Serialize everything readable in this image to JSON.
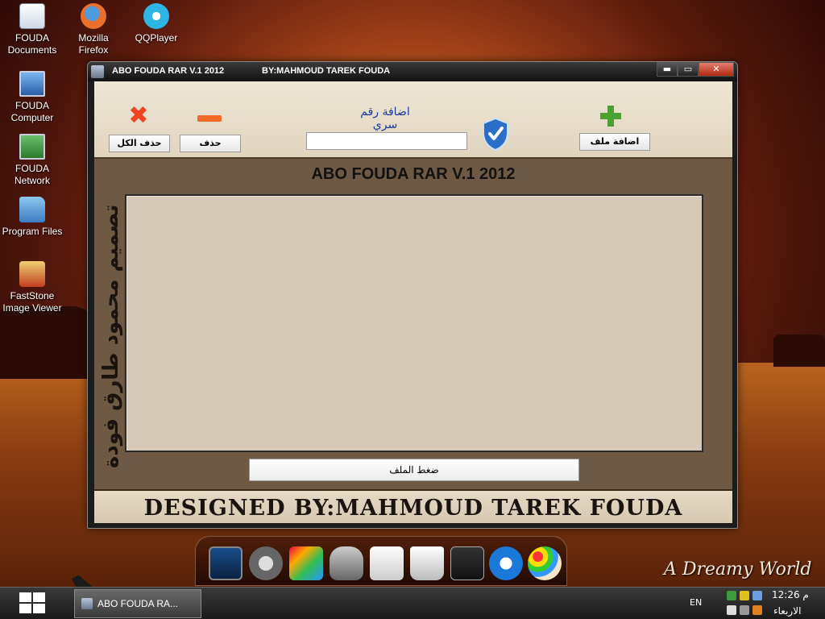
{
  "desktop": {
    "icons": [
      {
        "label_line1": "FOUDA",
        "label_line2": "Documents"
      },
      {
        "label_line1": "Mozilla",
        "label_line2": "Firefox"
      },
      {
        "label_line1": "QQPlayer",
        "label_line2": ""
      },
      {
        "label_line1": "FOUDA",
        "label_line2": "Computer"
      },
      {
        "label_line1": "FOUDA",
        "label_line2": "Network"
      },
      {
        "label_line1": "Program Files",
        "label_line2": ""
      },
      {
        "label_line1": "FastStone",
        "label_line2": "Image Viewer"
      }
    ],
    "watermark": "A Dreamy World"
  },
  "window": {
    "title": "ABO FOUDA RAR V.1 2012",
    "title_by": "BY:MAHMOUD TAREK FOUDA",
    "controls": {
      "minimize": "▬",
      "maximize": "▭",
      "close": "✕"
    }
  },
  "toolbar": {
    "delete_all_label": "حذف الكل",
    "delete_label": "حذف",
    "password_label": "اضافة رقم سري",
    "password_value": "",
    "add_file_label": "اضافة ملف"
  },
  "main": {
    "title": "ABO FOUDA RAR V.1 2012",
    "vertical_caption": "تصميم محمود طارق فودة",
    "compress_label": "ضغط الملف"
  },
  "footer": {
    "text": "DESIGNED BY:MAHMOUD TAREK FOUDA"
  },
  "taskbar": {
    "task_label": "ABO FOUDA RA...",
    "language": "EN",
    "time": "12:26 م",
    "day": "الاربعاء"
  },
  "colors": {
    "accent_blue": "#1a3a9a",
    "delete_red": "#ee4422",
    "minus_orange": "#f06a28",
    "add_green": "#4aa030",
    "shield_blue": "#2a6ec8"
  },
  "icons": [
    "close-x-icon",
    "minus-icon",
    "plus-icon",
    "shield-check-icon"
  ]
}
